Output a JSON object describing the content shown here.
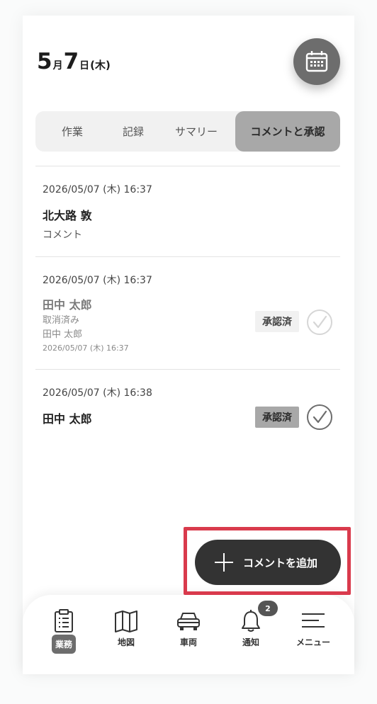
{
  "header": {
    "month": "5",
    "month_unit": "月",
    "day": "7",
    "day_unit": "日",
    "weekday": "(木)"
  },
  "tabs": [
    {
      "label": "作業",
      "active": false
    },
    {
      "label": "記録",
      "active": false
    },
    {
      "label": "サマリー",
      "active": false
    },
    {
      "label": "コメントと承認",
      "active": true
    }
  ],
  "entries": [
    {
      "timestamp": "2026/05/07 (木) 16:37",
      "name": "北大路 敦",
      "text": "コメント"
    },
    {
      "timestamp": "2026/05/07 (木) 16:37",
      "name": "田中 太郎",
      "status": "取消済み",
      "by": "田中 太郎",
      "by_time": "2026/05/07 (木) 16:37",
      "badge": "承認済"
    },
    {
      "timestamp": "2026/05/07 (木) 16:38",
      "name": "田中 太郎",
      "badge": "承認済"
    }
  ],
  "fab": {
    "label": "コメントを追加"
  },
  "bottom_nav": [
    {
      "label": "業務",
      "icon": "clipboard-icon",
      "active": true
    },
    {
      "label": "地図",
      "icon": "map-icon",
      "active": false
    },
    {
      "label": "車両",
      "icon": "car-icon",
      "active": false
    },
    {
      "label": "通知",
      "icon": "bell-icon",
      "active": false,
      "badge": "2"
    },
    {
      "label": "メニュー",
      "icon": "menu-icon",
      "active": false
    }
  ],
  "colors": {
    "accent_dark": "#333333",
    "gray": "#6d6d6d",
    "highlight": "#d93a4c"
  }
}
